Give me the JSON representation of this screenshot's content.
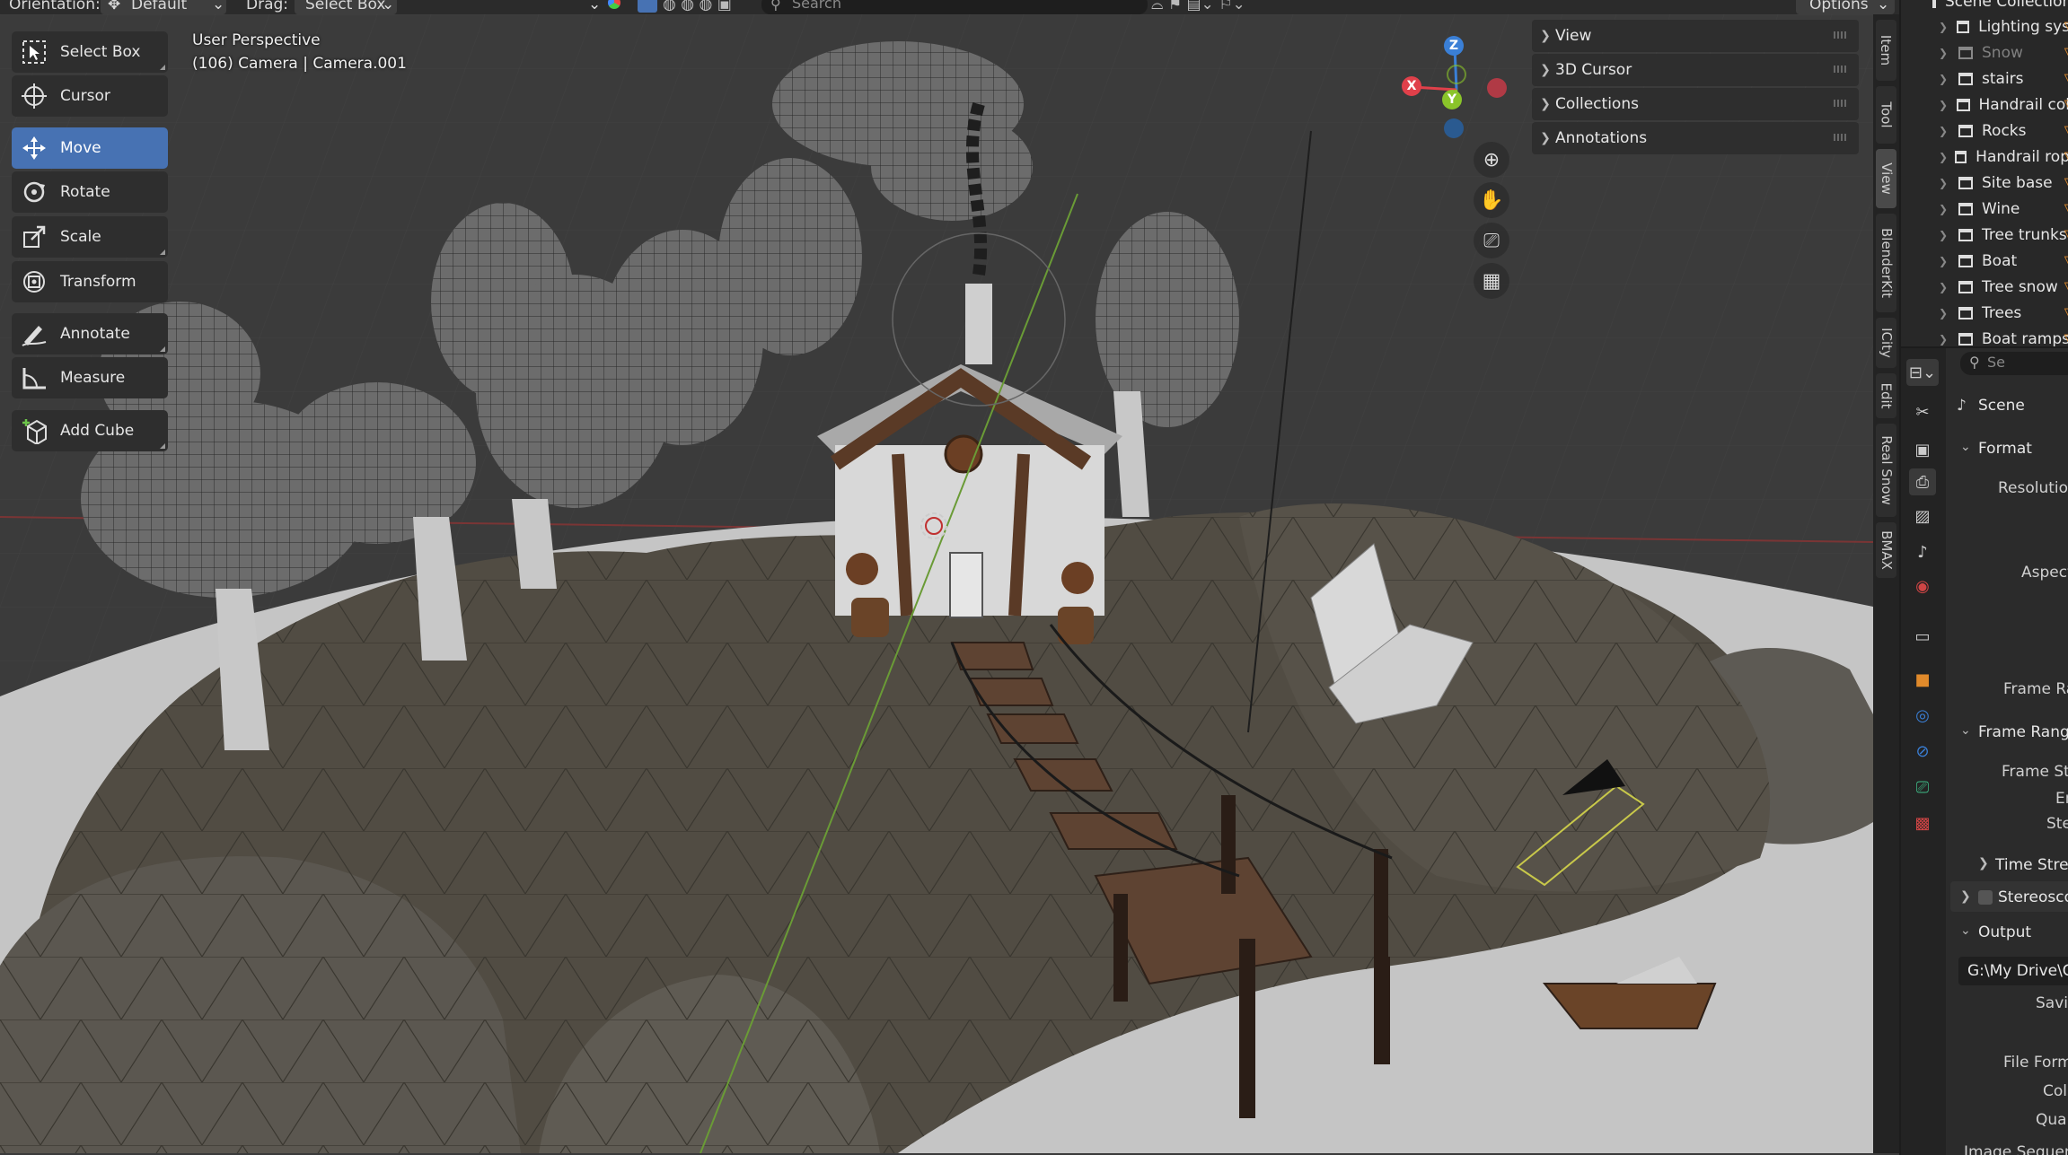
{
  "header": {
    "orientation_label": "Orientation:",
    "orientation_value": "Default",
    "drag_label": "Drag:",
    "drag_value": "Select Box",
    "search_placeholder": "Search",
    "options_label": "Options"
  },
  "viewport": {
    "view_name": "User Perspective",
    "view_subtitle": "(106) Camera | Camera.001"
  },
  "toolbar": {
    "tools": [
      {
        "label": "Select Box",
        "icon": "select-box-icon",
        "active": false
      },
      {
        "label": "Cursor",
        "icon": "cursor-icon",
        "active": false
      },
      {
        "label": "Move",
        "icon": "move-icon",
        "active": true
      },
      {
        "label": "Rotate",
        "icon": "rotate-icon",
        "active": false
      },
      {
        "label": "Scale",
        "icon": "scale-icon",
        "active": false
      },
      {
        "label": "Transform",
        "icon": "transform-icon",
        "active": false
      },
      {
        "label": "Annotate",
        "icon": "annotate-icon",
        "active": false
      },
      {
        "label": "Measure",
        "icon": "measure-icon",
        "active": false
      },
      {
        "label": "Add Cube",
        "icon": "add-cube-icon",
        "active": false
      }
    ]
  },
  "gizmo": {
    "x": "X",
    "y": "Y",
    "z": "Z",
    "colors": {
      "x": "#e0404a",
      "y": "#8ac42a",
      "z": "#3a7fd6",
      "neg_x": "#b03a45",
      "neg_z": "#2a5a90"
    }
  },
  "npanel": {
    "sections": [
      "View",
      "3D Cursor",
      "Collections",
      "Annotations"
    ]
  },
  "side_tabs": [
    "Item",
    "Tool",
    "View",
    "BlenderKit",
    "ICity",
    "Edit",
    "Real Snow",
    "BMAX"
  ],
  "outliner": {
    "header": "Scene Collection",
    "items": [
      {
        "name": "Lighting sys",
        "dim": false
      },
      {
        "name": "Snow",
        "dim": true
      },
      {
        "name": "stairs",
        "dim": false
      },
      {
        "name": "Handrail col",
        "dim": false
      },
      {
        "name": "Rocks",
        "dim": false
      },
      {
        "name": "Handrail rop",
        "dim": false
      },
      {
        "name": "Site base",
        "dim": false
      },
      {
        "name": "Wine",
        "dim": false
      },
      {
        "name": "Tree trunks",
        "dim": false
      },
      {
        "name": "Boat",
        "dim": false
      },
      {
        "name": "Tree snow",
        "dim": false
      },
      {
        "name": "Trees",
        "dim": false
      },
      {
        "name": "Boat ramps",
        "dim": false
      }
    ]
  },
  "properties": {
    "context": "Scene",
    "search_placeholder": "Se",
    "format_section": "Format",
    "resolution": "Resolution",
    "aspect": "Aspect",
    "frame_rate": "Frame Ra",
    "frame_range_section": "Frame Range",
    "frame_start": "Frame Sta",
    "frame_end": "En",
    "frame_step": "Ste",
    "time_stretch": "Time Stret",
    "stereoscopy": "Stereosco",
    "output_section": "Output",
    "output_path": "G:\\My Drive\\C",
    "saving": "Savin",
    "file_format": "File Form",
    "color": "Col",
    "quality": "Quali",
    "image_sequence": "Image Sequen"
  }
}
